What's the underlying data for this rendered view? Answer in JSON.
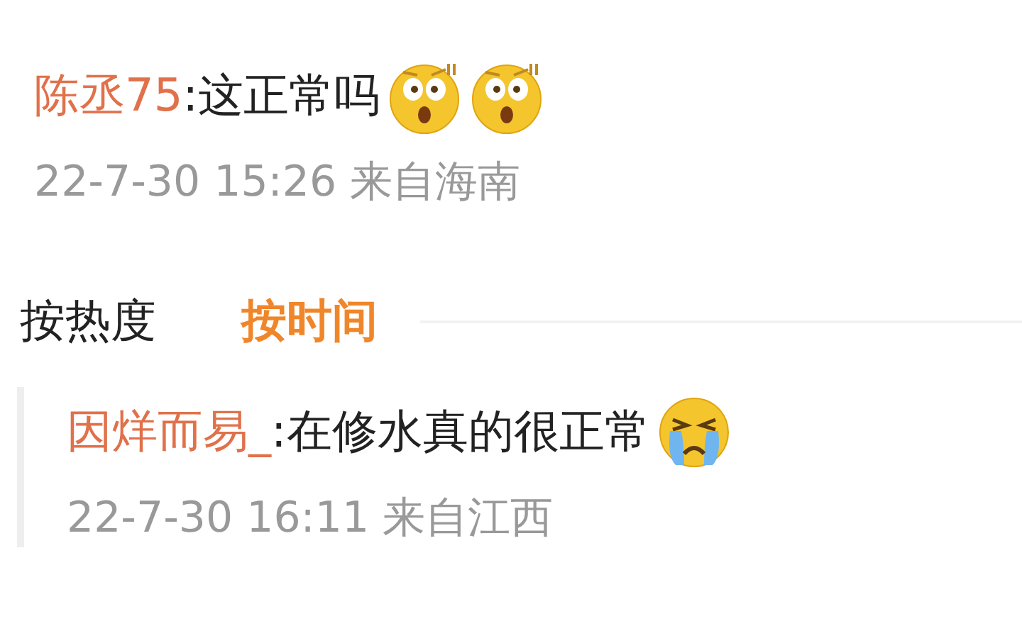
{
  "comment": {
    "user": "陈丞75",
    "text": " :这正常吗",
    "emojis": [
      {
        "kind": "surprised"
      },
      {
        "kind": "surprised"
      }
    ],
    "meta": "22-7-30 15:26 来自海南"
  },
  "sort_tabs": [
    {
      "label": "按热度",
      "selected": false
    },
    {
      "label": "按时间",
      "selected": true
    }
  ],
  "replies": [
    {
      "user": "因烊而易_",
      "text": ":在修水真的很正常",
      "emojis": [
        {
          "kind": "crying"
        }
      ],
      "meta": "22-7-30 16:11 来自江西"
    }
  ]
}
